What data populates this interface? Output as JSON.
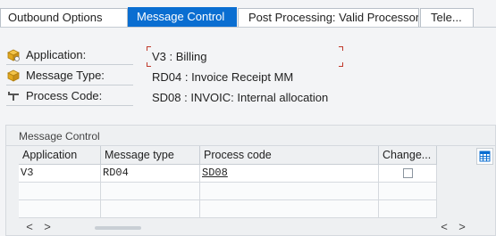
{
  "tabs": [
    {
      "label": "Outbound Options",
      "active": false
    },
    {
      "label": "Message Control",
      "active": true
    },
    {
      "label": "Post Processing: Valid Processors",
      "active": false
    },
    {
      "label": "Tele...",
      "active": false
    }
  ],
  "header_fields": [
    {
      "icon": "application-cube-icon",
      "label": "Application:",
      "value": "V3 : Billing"
    },
    {
      "icon": "message-type-cube-icon",
      "label": "Message Type:",
      "value": "RD04 : Invoice Receipt MM"
    },
    {
      "icon": "process-code-icon",
      "label": "Process Code:",
      "value": "SD08 : INVOIC: Internal allocation"
    }
  ],
  "message_control": {
    "title": "Message Control",
    "columns": [
      "Application",
      "Message type",
      "Process code",
      "Change..."
    ],
    "rows": [
      {
        "application": "V3",
        "message_type": "RD04",
        "process_code": "SD08",
        "change_checked": false
      }
    ]
  },
  "scroll": {
    "left": "<",
    "right": ">"
  },
  "colors": {
    "accent": "#0a6ed1",
    "focus_marker": "#c0392b",
    "icon_gold": "#e2a81e"
  }
}
